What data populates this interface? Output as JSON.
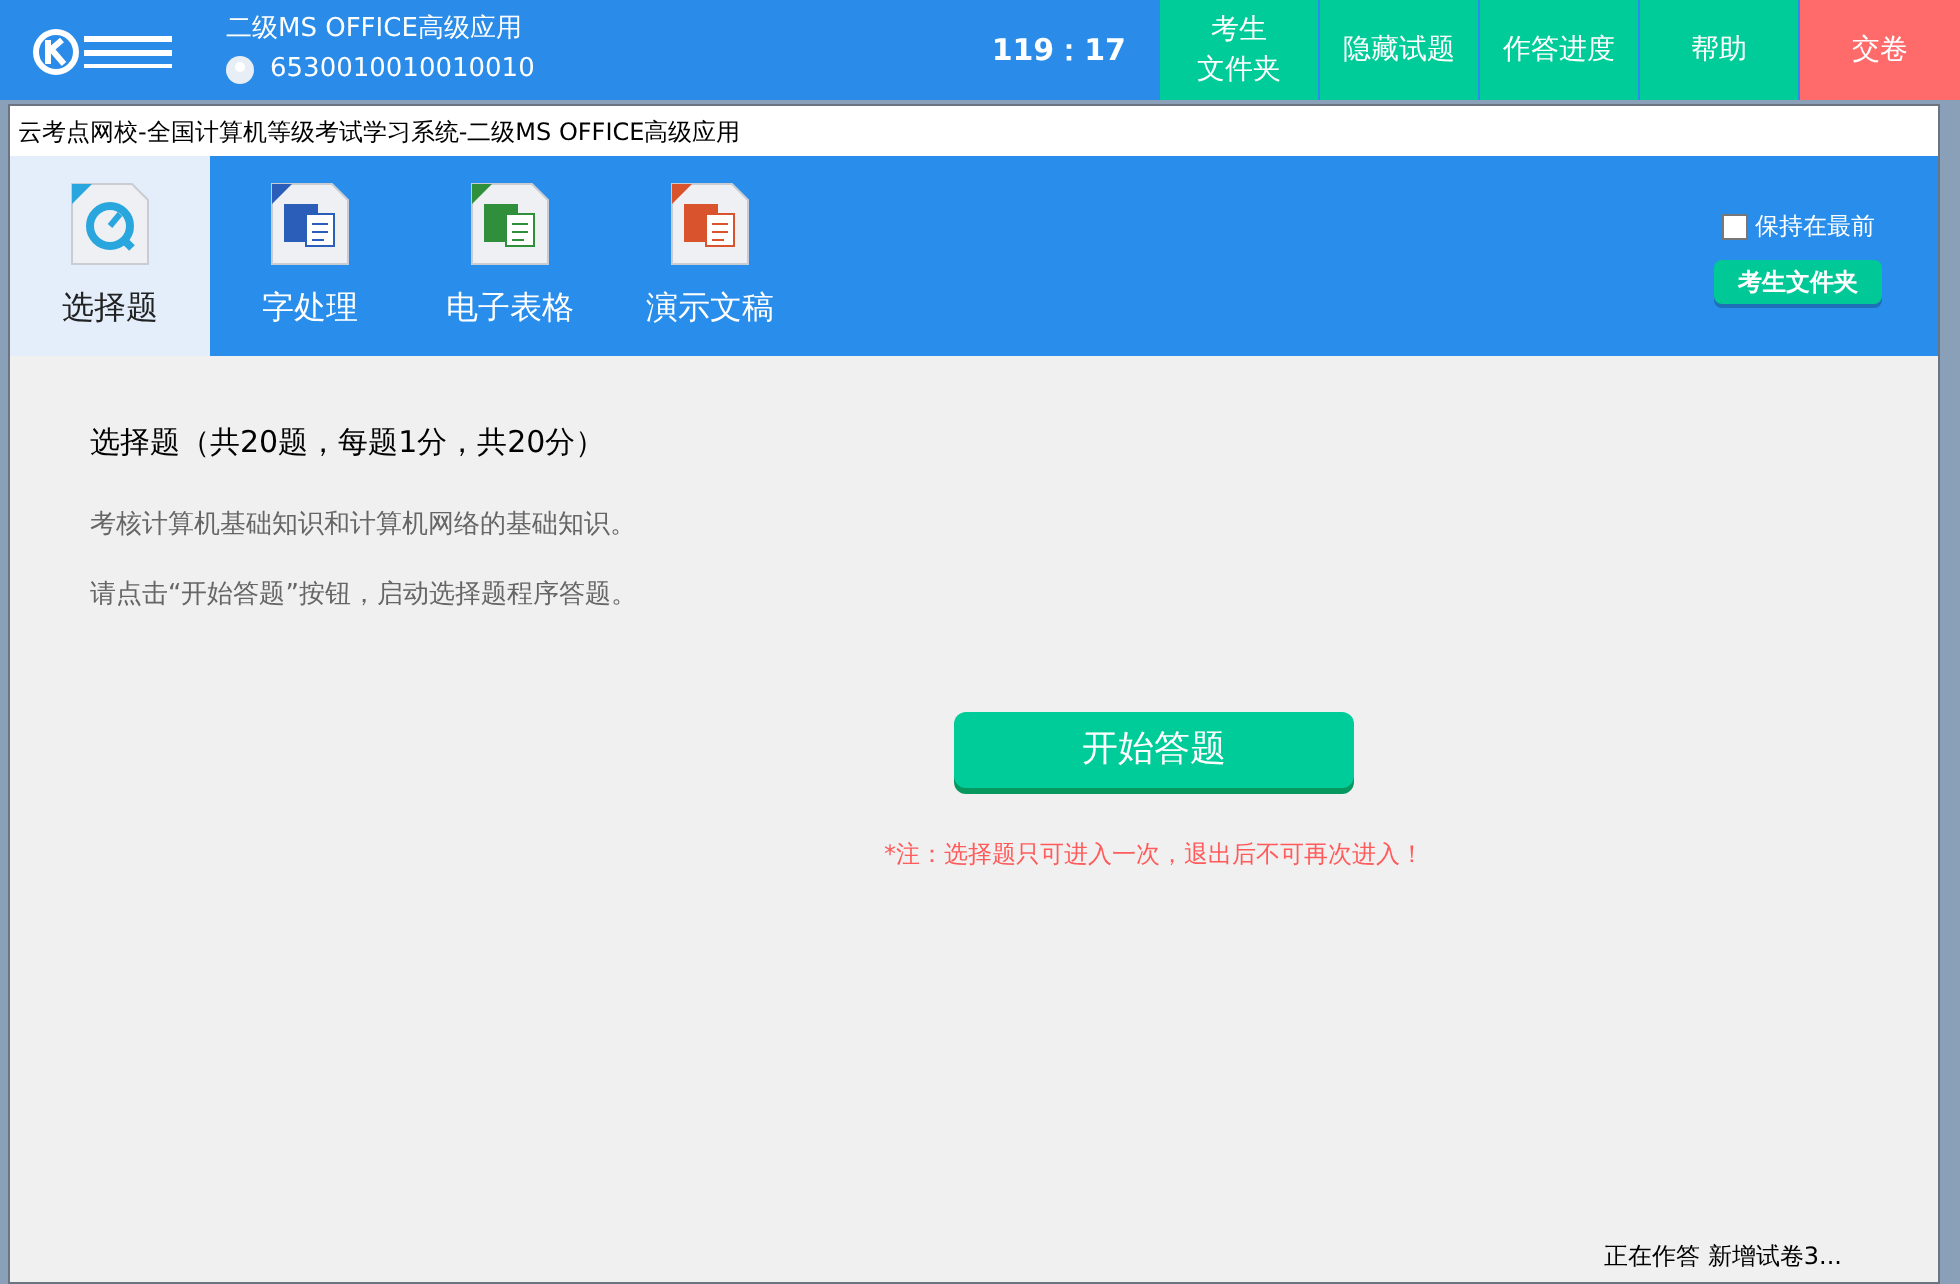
{
  "header": {
    "exam": "二级MS OFFICE高级应用",
    "candidate_id": "6530010010010010",
    "timer": "119：17",
    "buttons": [
      {
        "lines": [
          "考生",
          "文件夹"
        ],
        "kind": "normal"
      },
      {
        "lines": [
          "隐藏试题"
        ],
        "kind": "normal"
      },
      {
        "lines": [
          "作答进度"
        ],
        "kind": "normal"
      },
      {
        "lines": [
          "帮助"
        ],
        "kind": "normal"
      },
      {
        "lines": [
          "交卷"
        ],
        "kind": "danger"
      }
    ]
  },
  "window": {
    "title": "云考点网校-全国计算机等级考试学习系统-二级MS OFFICE高级应用"
  },
  "tabs": [
    {
      "label": "选择题",
      "kind": "quiz",
      "selected": true
    },
    {
      "label": "字处理",
      "kind": "word",
      "selected": false
    },
    {
      "label": "电子表格",
      "kind": "excel",
      "selected": false
    },
    {
      "label": "演示文稿",
      "kind": "ppt",
      "selected": false
    }
  ],
  "keep_on_top": {
    "label": "保持在最前",
    "checked": false
  },
  "folder_button": "考生文件夹",
  "content": {
    "heading": "选择题（共20题，每题1分，共20分）",
    "lines": [
      "考核计算机基础知识和计算机网络的基础知识。",
      "请点击“开始答题”按钮，启动选择题程序答题。"
    ],
    "start_button": "开始答题",
    "note": "*注：选择题只可进入一次，退出后不可再次进入！"
  },
  "status_bar": "正在作答 新增试卷3..."
}
